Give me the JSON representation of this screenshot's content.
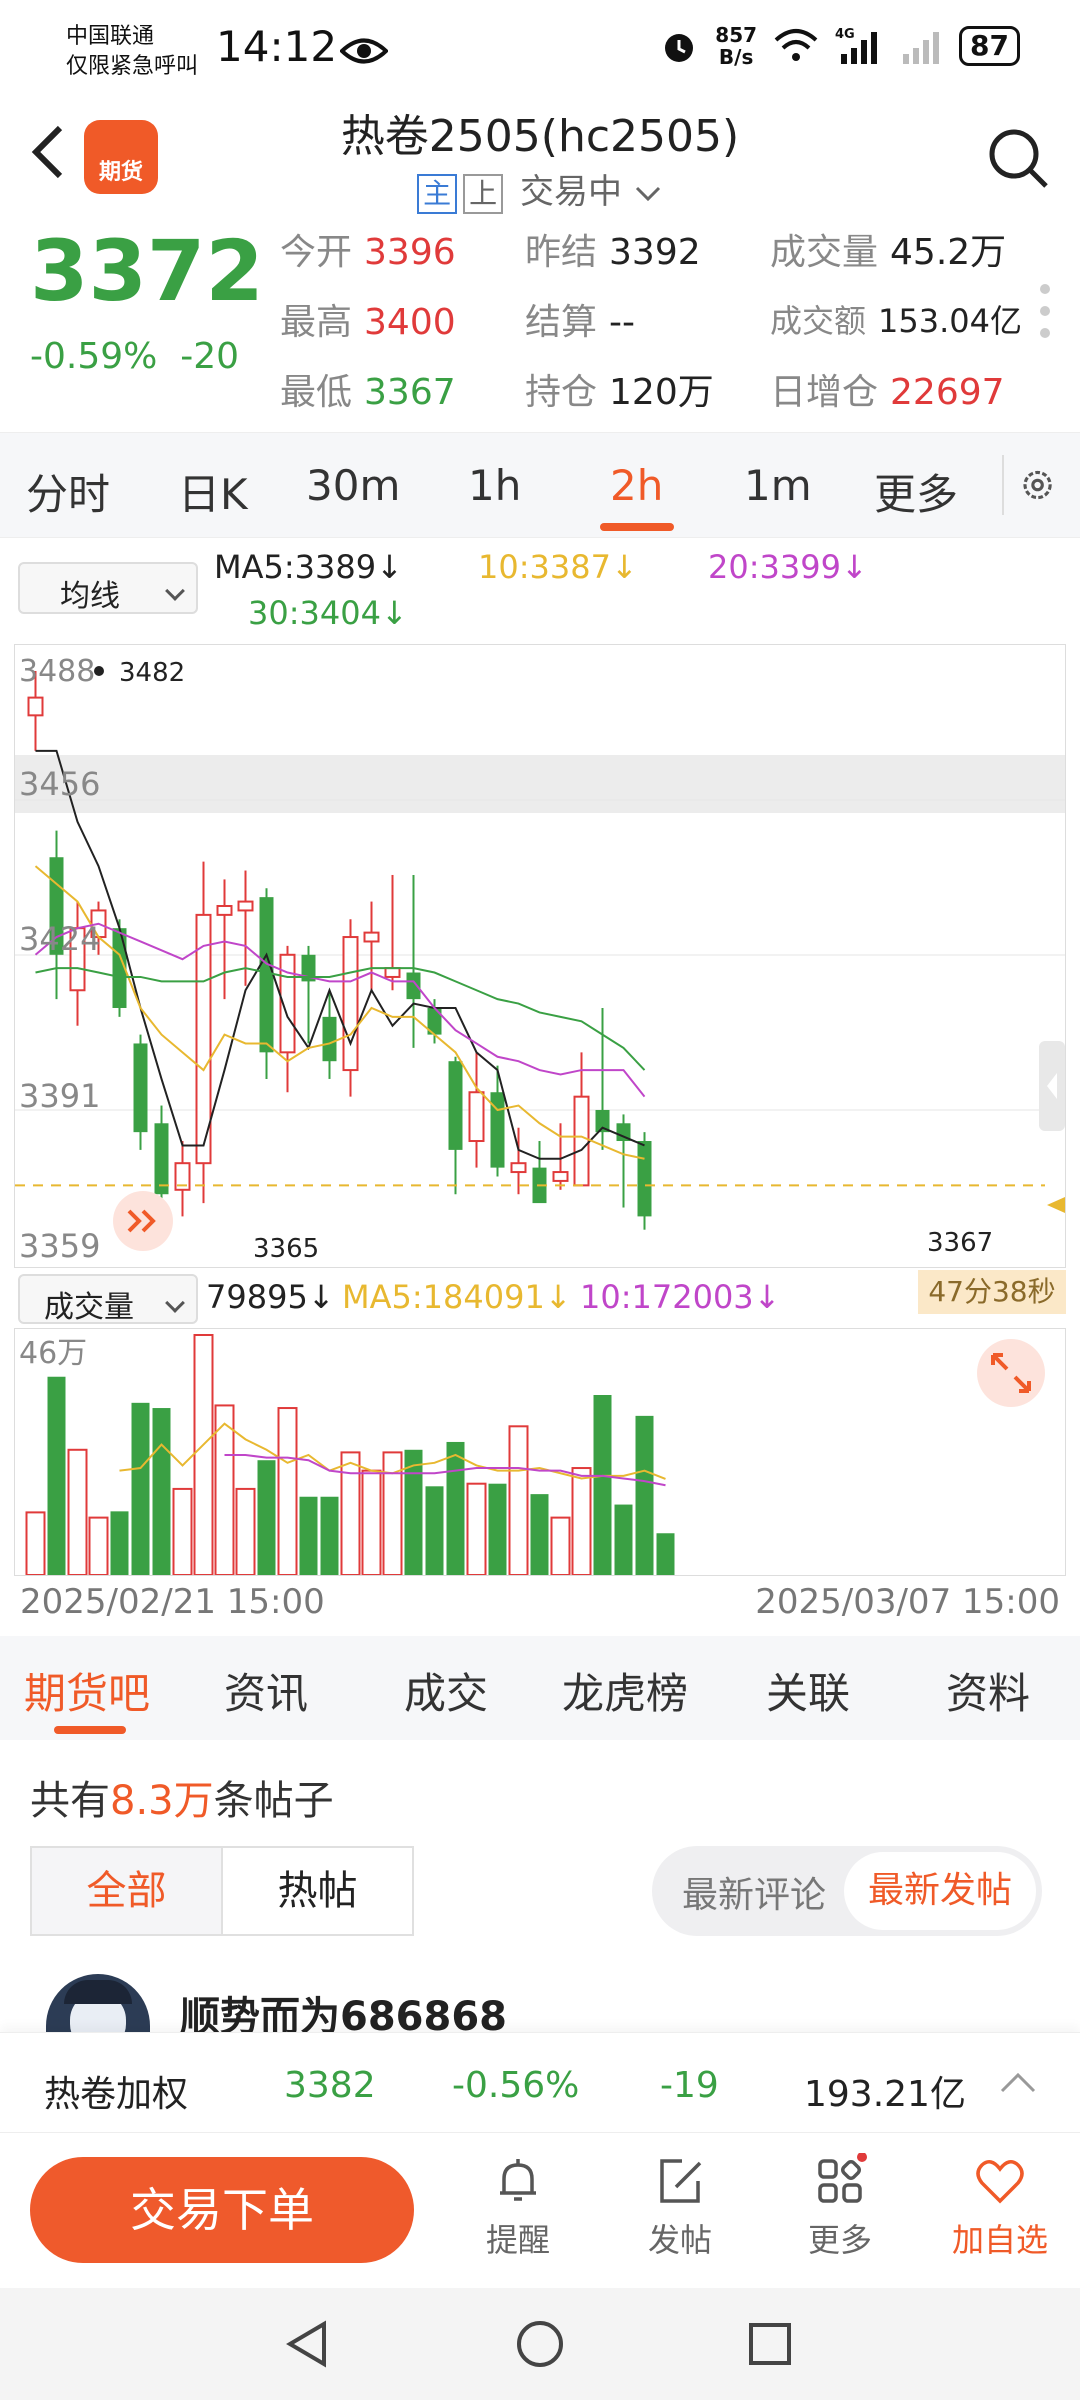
{
  "status": {
    "carrier_line1": "中国联通",
    "carrier_line2": "仅限紧急呼叫",
    "time": "14:12",
    "net_speed_value": "857",
    "net_speed_unit": "B/s",
    "battery": "87"
  },
  "header": {
    "logo_label": "期货",
    "title": "热卷2505(hc2505)",
    "tag_main": "主",
    "tag_up": "上",
    "trading_status": "交易中"
  },
  "quote": {
    "price": "3372",
    "change_pct": "-0.59%",
    "change": "-20",
    "open_label": "今开",
    "open": "3396",
    "prev_close_label": "昨结",
    "prev_close": "3392",
    "volume_label": "成交量",
    "volume": "45.2万",
    "high_label": "最高",
    "high": "3400",
    "settle_label": "结算",
    "settle": "--",
    "turnover_label": "成交额",
    "turnover": "153.04亿",
    "low_label": "最低",
    "low": "3367",
    "oi_label": "持仓",
    "oi": "120万",
    "oi_change_label": "日增仓",
    "oi_change": "22697"
  },
  "period_tabs": [
    "分时",
    "日K",
    "30m",
    "1h",
    "2h",
    "1m",
    "更多"
  ],
  "active_period": "2h",
  "ma": {
    "selector": "均线",
    "ma5": "MA5:3389",
    "ma10": "10:3387",
    "ma20": "20:3399",
    "ma30": "30:3404",
    "arrow": "↓"
  },
  "price_axis": {
    "labels": [
      "3488",
      "3456",
      "3424",
      "3391",
      "3359"
    ],
    "max_label": "3482",
    "min_label_left": "3365",
    "min_label_right": "3367"
  },
  "countdown": "47分38秒",
  "volume_panel": {
    "selector": "成交量",
    "vol": "79895",
    "ma5": "MA5:184091",
    "ma10": "10:172003",
    "arrow": "↓",
    "axis_max": "46万"
  },
  "dates": {
    "start": "2025/02/21 15:00",
    "end": "2025/03/07 15:00"
  },
  "content_tabs": [
    "期货吧",
    "资讯",
    "成交",
    "龙虎榜",
    "关联",
    "资料"
  ],
  "posts": {
    "prefix": "共有",
    "count": "8.3万",
    "suffix": "条帖子",
    "filter_all": "全部",
    "filter_hot": "热帖",
    "sort_comment": "最新评论",
    "sort_post": "最新发帖",
    "first_user": "顺势而为686868"
  },
  "summary": {
    "name": "热卷加权",
    "price": "3382",
    "change_pct": "-0.56%",
    "change": "-19",
    "turnover": "193.21亿"
  },
  "bottom": {
    "trade": "交易下单",
    "remind": "提醒",
    "post": "发帖",
    "more": "更多",
    "watch": "加自选"
  },
  "colors": {
    "up": "#e03a3a",
    "down": "#3aa044",
    "accent": "#f05a28"
  },
  "chart_data": {
    "type": "candlestick",
    "ylim": [
      3359,
      3488
    ],
    "candles": [
      {
        "o": 3478,
        "c": 3482,
        "h": 3488,
        "l": 3470
      },
      {
        "o": 3446,
        "c": 3424,
        "h": 3452,
        "l": 3414
      },
      {
        "o": 3416,
        "c": 3430,
        "h": 3436,
        "l": 3408
      },
      {
        "o": 3428,
        "c": 3434,
        "h": 3436,
        "l": 3424
      },
      {
        "o": 3430,
        "c": 3412,
        "h": 3432,
        "l": 3410
      },
      {
        "o": 3404,
        "c": 3384,
        "h": 3406,
        "l": 3380
      },
      {
        "o": 3386,
        "c": 3370,
        "h": 3390,
        "l": 3366
      },
      {
        "o": 3371,
        "c": 3377,
        "h": 3382,
        "l": 3365
      },
      {
        "o": 3377,
        "c": 3433,
        "h": 3445,
        "l": 3368
      },
      {
        "o": 3433,
        "c": 3435,
        "h": 3441,
        "l": 3414
      },
      {
        "o": 3434,
        "c": 3436,
        "h": 3443,
        "l": 3417
      },
      {
        "o": 3437,
        "c": 3402,
        "h": 3439,
        "l": 3396
      },
      {
        "o": 3402,
        "c": 3424,
        "h": 3426,
        "l": 3393
      },
      {
        "o": 3424,
        "c": 3418,
        "h": 3426,
        "l": 3404
      },
      {
        "o": 3410,
        "c": 3400,
        "h": 3416,
        "l": 3396
      },
      {
        "o": 3398,
        "c": 3428,
        "h": 3432,
        "l": 3392
      },
      {
        "o": 3427,
        "c": 3429,
        "h": 3436,
        "l": 3416
      },
      {
        "o": 3419,
        "c": 3421,
        "h": 3442,
        "l": 3416
      },
      {
        "o": 3420,
        "c": 3414,
        "h": 3442,
        "l": 3403
      },
      {
        "o": 3412,
        "c": 3406,
        "h": 3414,
        "l": 3404
      },
      {
        "o": 3400,
        "c": 3380,
        "h": 3401,
        "l": 3370
      },
      {
        "o": 3382,
        "c": 3393,
        "h": 3402,
        "l": 3376
      },
      {
        "o": 3393,
        "c": 3376,
        "h": 3399,
        "l": 3374
      },
      {
        "o": 3375,
        "c": 3377,
        "h": 3385,
        "l": 3370
      },
      {
        "o": 3376,
        "c": 3368,
        "h": 3382,
        "l": 3371
      },
      {
        "o": 3373,
        "c": 3375,
        "h": 3386,
        "l": 3371
      },
      {
        "o": 3372,
        "c": 3392,
        "h": 3402,
        "l": 3373
      },
      {
        "o": 3389,
        "c": 3384,
        "h": 3412,
        "l": 3380
      },
      {
        "o": 3386,
        "c": 3382,
        "h": 3388,
        "l": 3367
      },
      {
        "o": 3382,
        "c": 3365,
        "h": 3384,
        "l": 3362
      }
    ],
    "ma_lines": [
      {
        "name": "MA5",
        "color": "#222222",
        "values": [
          3470,
          3470,
          3454,
          3444,
          3430,
          3412,
          3396,
          3381,
          3381,
          3398,
          3416,
          3424,
          3410,
          3403,
          3416,
          3404,
          3416,
          3408,
          3413,
          3412,
          3412,
          3402,
          3398,
          3380,
          3378,
          3378,
          3380,
          3385,
          3383,
          3381
        ]
      },
      {
        "name": "MA10",
        "color": "#e8b830",
        "values": [
          3444,
          3440,
          3436,
          3428,
          3424,
          3412,
          3406,
          3402,
          3398,
          3406,
          3404,
          3404,
          3400,
          3403,
          3404,
          3406,
          3412,
          3410,
          3410,
          3406,
          3402,
          3394,
          3389,
          3390,
          3386,
          3383,
          3383,
          3381,
          3379,
          3378
        ]
      },
      {
        "name": "MA20",
        "color": "#c046c9",
        "values": [
          3424,
          3428,
          3430,
          3431,
          3429,
          3427,
          3425,
          3423,
          3426,
          3427,
          3426,
          3422,
          3420,
          3419,
          3418,
          3418,
          3420,
          3418,
          3418,
          3412,
          3407,
          3404,
          3401,
          3400,
          3398,
          3397,
          3398,
          3398,
          3398,
          3392
        ]
      },
      {
        "name": "MA30",
        "color": "#3aa044",
        "values": [
          3420,
          3421,
          3421,
          3420,
          3419,
          3419,
          3418,
          3418,
          3418,
          3420,
          3421,
          3420,
          3419,
          3419,
          3419,
          3420,
          3421,
          3421,
          3421,
          3420,
          3418,
          3416,
          3414,
          3413,
          3411,
          3410,
          3409,
          3406,
          3403,
          3398
        ]
      }
    ],
    "volume": {
      "max": 460000,
      "bars": [
        120000,
        380000,
        240000,
        110000,
        122000,
        330000,
        320000,
        165000,
        460000,
        325000,
        165000,
        220000,
        320000,
        150000,
        150000,
        235000,
        200000,
        235000,
        240000,
        170000,
        255000,
        175000,
        175000,
        285000,
        155000,
        110000,
        205000,
        345000,
        135000,
        305000,
        80000
      ],
      "ma5": [
        null,
        null,
        null,
        null,
        200000,
        205000,
        250000,
        210000,
        250000,
        290000,
        260000,
        240000,
        215000,
        230000,
        200000,
        215000,
        200000,
        195000,
        210000,
        215000,
        230000,
        210000,
        200000,
        200000,
        205000,
        195000,
        185000,
        190000,
        190000,
        200000,
        184091
      ],
      "ma10": [
        null,
        null,
        null,
        null,
        null,
        null,
        null,
        null,
        null,
        230000,
        230000,
        225000,
        225000,
        220000,
        200000,
        195000,
        195000,
        195000,
        195000,
        195000,
        200000,
        205000,
        205000,
        205000,
        200000,
        200000,
        190000,
        190000,
        185000,
        180000,
        172003
      ]
    }
  }
}
